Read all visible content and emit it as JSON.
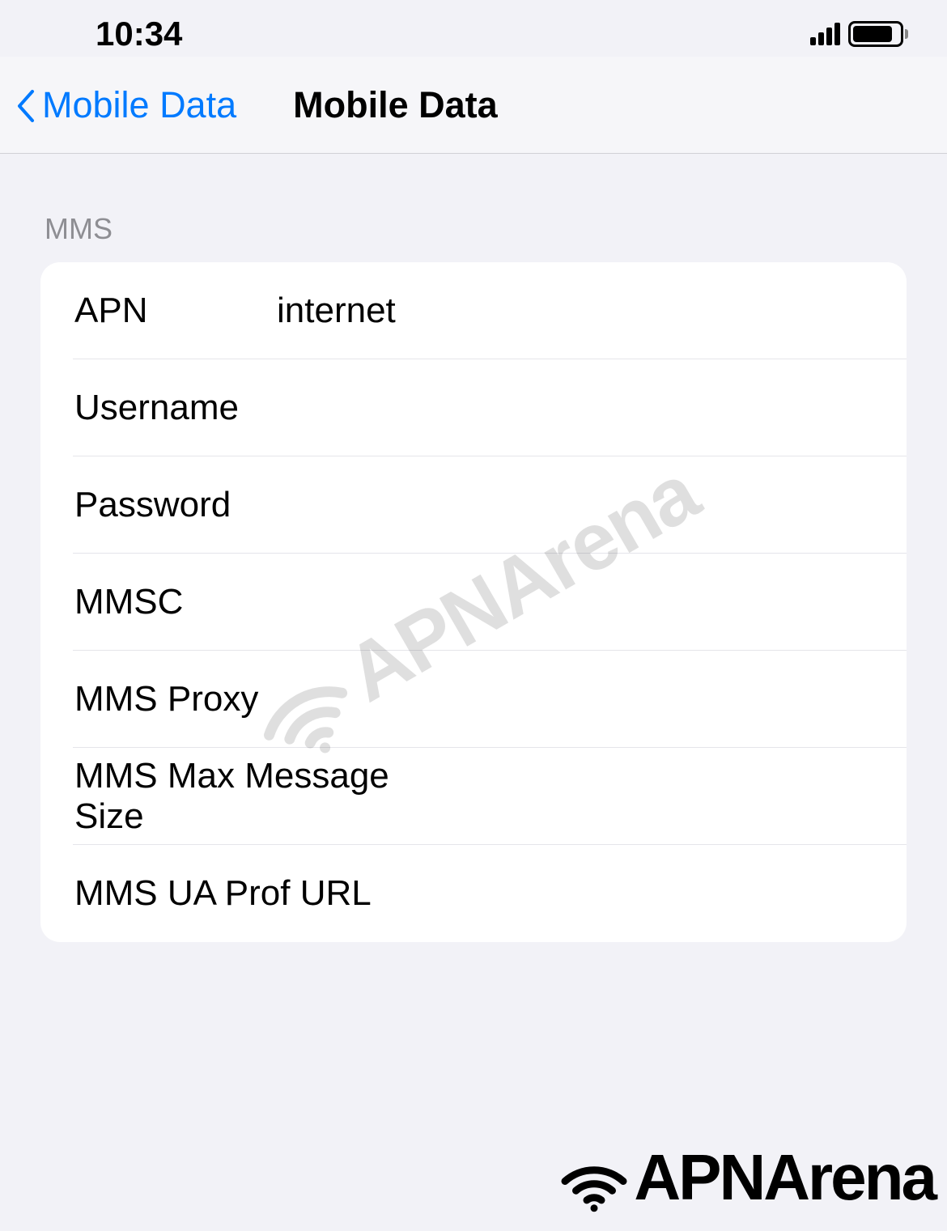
{
  "status_bar": {
    "time": "10:34"
  },
  "nav": {
    "back_label": "Mobile Data",
    "title": "Mobile Data"
  },
  "section": {
    "header": "MMS"
  },
  "fields": {
    "apn": {
      "label": "APN",
      "value": "internet"
    },
    "username": {
      "label": "Username",
      "value": ""
    },
    "password": {
      "label": "Password",
      "value": ""
    },
    "mmsc": {
      "label": "MMSC",
      "value": ""
    },
    "mms_proxy": {
      "label": "MMS Proxy",
      "value": ""
    },
    "mms_max_size": {
      "label": "MMS Max Message Size",
      "value": ""
    },
    "mms_ua_prof": {
      "label": "MMS UA Prof URL",
      "value": ""
    }
  },
  "branding": {
    "name": "APNArena"
  }
}
